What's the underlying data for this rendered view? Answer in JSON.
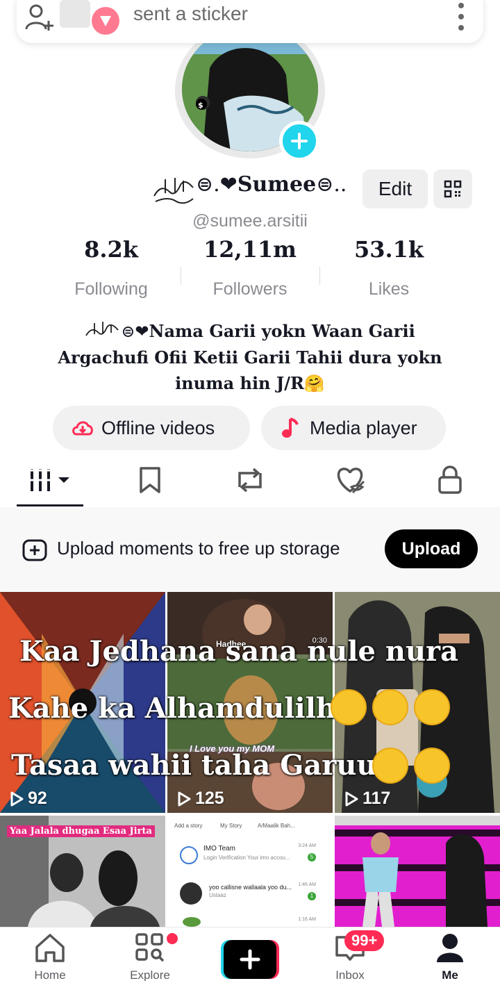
{
  "notification": {
    "text": "sent a sticker"
  },
  "profile": {
    "name": "Sumee",
    "handle": "@sumee.arsitii",
    "edit_label": "Edit"
  },
  "stats": [
    {
      "value": "8.2k",
      "label": "Following"
    },
    {
      "value": "12,11m",
      "label": "Followers"
    },
    {
      "value": "53.1k",
      "label": "Likes"
    }
  ],
  "bio": {
    "line1": "Nama Garii yokn Waan Garii",
    "line2": "Argachufi Ofii Ketii Garii Tahii dura yokn",
    "line3": "inuma hin J/R🤗"
  },
  "actions": {
    "offline_label": "Offline videos",
    "media_label": "Media player"
  },
  "tabs": [
    "videos-icon",
    "bookmark-icon",
    "repost-icon",
    "liked-icon",
    "lock-icon"
  ],
  "storage": {
    "text": "Upload moments to free up storage",
    "button": "Upload"
  },
  "videos": [
    {
      "views": "92"
    },
    {
      "views": "125"
    },
    {
      "views": "117"
    }
  ],
  "overlay": {
    "line1": "Kaa Jedhana sana nule nura",
    "line2": "Kahe ka Alhamdulilh",
    "line3": "Tasaa wahii taha Garuu"
  },
  "thumbs": {
    "cell2_tag": "Hadhee",
    "cell2_time": "0:30",
    "cell2_caption": "I Love you my MOM",
    "cell4_caption": "Yaa Jalala dhugaa Esaa Jirta",
    "chat_tabs": [
      "Add a story",
      "My Story",
      "A/Maalik Bah..."
    ],
    "chat_rows": [
      {
        "name": "IMO Team",
        "preview": "Login Verification Your imo accou...",
        "time": "3:24 AM",
        "count": "5"
      },
      {
        "name": "yoo callisne wallaala yoo du...",
        "preview": "Ustaaz",
        "time": "1:46 AM",
        "count": "1"
      },
      {
        "name": "",
        "preview": "",
        "time": "1:16 AM",
        "count": ""
      }
    ]
  },
  "nav": {
    "home": "Home",
    "explore": "Explore",
    "inbox": "Inbox",
    "inbox_badge": "99+",
    "me": "Me"
  },
  "colors": {
    "accent_red": "#fe2c55",
    "accent_cyan": "#20d5ec",
    "text_primary": "#161823",
    "text_secondary": "#8a8b91"
  }
}
